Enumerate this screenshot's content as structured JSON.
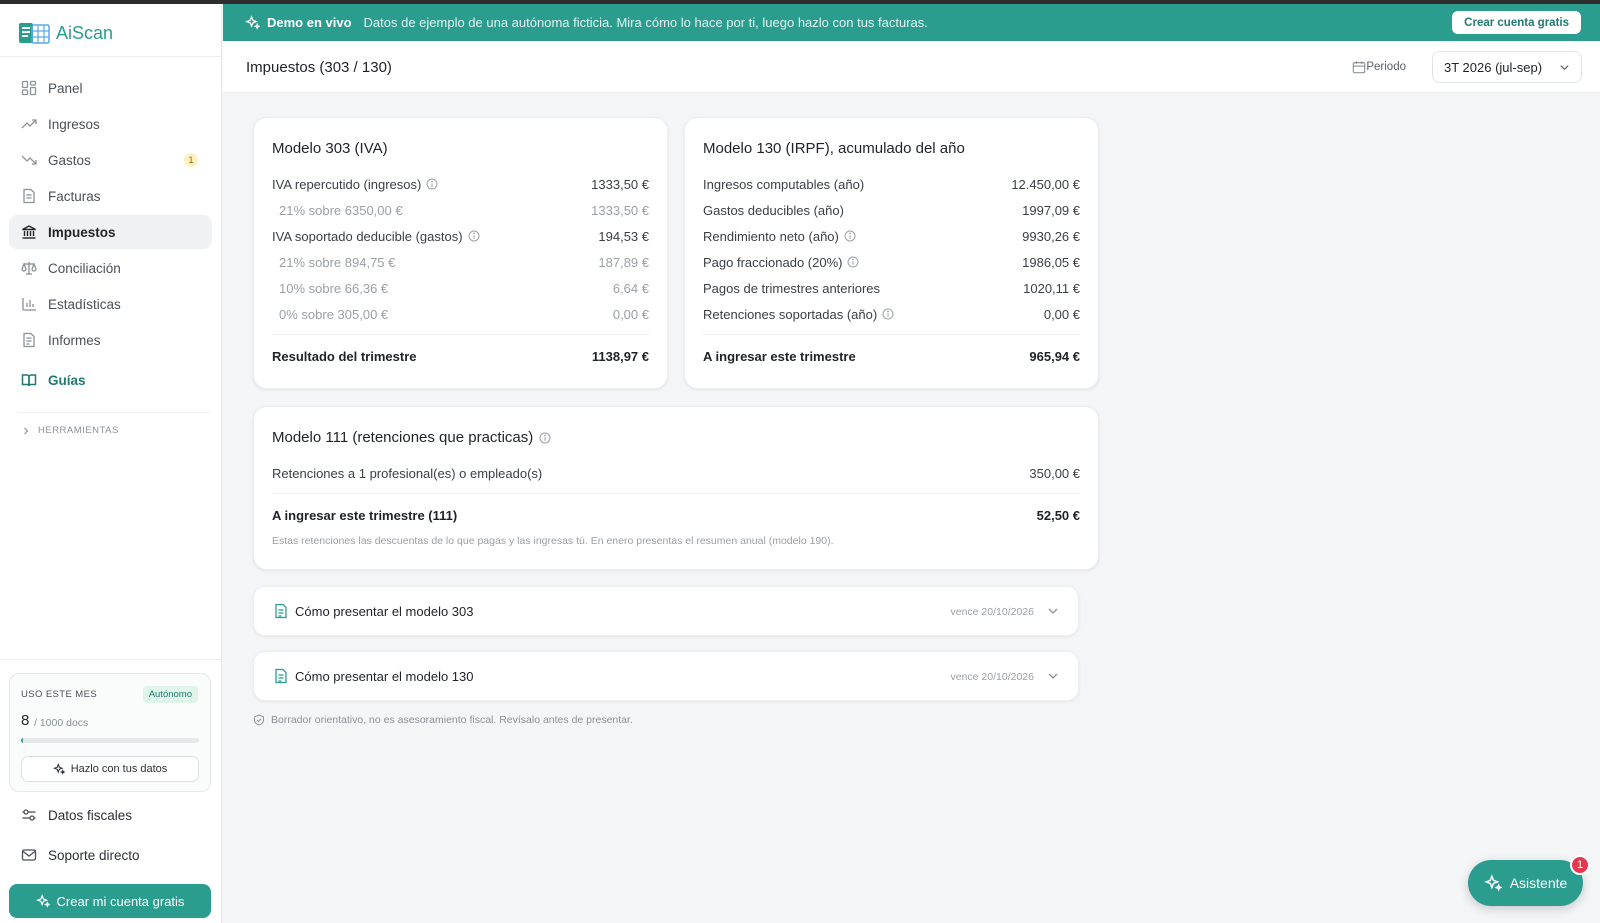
{
  "app": {
    "logo_text": "AiScan"
  },
  "sidebar": {
    "items": [
      {
        "label": "Panel",
        "icon": "dashboard-icon"
      },
      {
        "label": "Ingresos",
        "icon": "trend-up-icon"
      },
      {
        "label": "Gastos",
        "icon": "trend-down-icon",
        "badge": "1"
      },
      {
        "label": "Facturas",
        "icon": "document-icon"
      },
      {
        "label": "Impuestos",
        "icon": "bank-icon",
        "active": true
      },
      {
        "label": "Conciliación",
        "icon": "scale-icon"
      },
      {
        "label": "Estadísticas",
        "icon": "bar-chart-icon"
      },
      {
        "label": "Informes",
        "icon": "report-icon"
      }
    ],
    "guide_label": "Guías",
    "tools_label": "HERRAMIENTAS",
    "usage": {
      "label": "USO ESTE MES",
      "plan": "Autónomo",
      "count": "8",
      "total": "/ 1000 docs",
      "fraction": 0.008,
      "button": "Hazlo con tus datos"
    },
    "fiscal_data": "Datos fiscales",
    "support": "Soporte directo",
    "create_account": "Crear mi cuenta gratis"
  },
  "banner": {
    "title": "Demo en vivo",
    "text": "Datos de ejemplo de una autónoma ficticia. Mira cómo lo hace por ti, luego hazlo con tus facturas.",
    "button": "Crear cuenta gratis",
    "color": "#2a9d8f"
  },
  "header": {
    "title": "Impuestos (303 / 130)",
    "period_label": "Periodo",
    "period_value": "3T 2026 (jul-sep)"
  },
  "model303": {
    "title": "Modelo 303 (IVA)",
    "rows": [
      {
        "label": "IVA repercutido (ingresos)",
        "value": "1333,50 €",
        "info": true
      },
      {
        "label": "21% sobre 6350,00 €",
        "value": "1333,50 €",
        "sub": true
      },
      {
        "label": "IVA soportado deducible (gastos)",
        "value": "194,53 €",
        "info": true
      },
      {
        "label": "21% sobre 894,75 €",
        "value": "187,89 €",
        "sub": true
      },
      {
        "label": "10% sobre 66,36 €",
        "value": "6,64 €",
        "sub": true
      },
      {
        "label": "0% sobre 305,00 €",
        "value": "0,00 €",
        "sub": true
      }
    ],
    "total_label": "Resultado del trimestre",
    "total_value": "1138,97 €"
  },
  "model130": {
    "title": "Modelo 130 (IRPF), acumulado del año",
    "rows": [
      {
        "label": "Ingresos computables (año)",
        "value": "12.450,00 €"
      },
      {
        "label": "Gastos deducibles (año)",
        "value": "1997,09 €"
      },
      {
        "label": "Rendimiento neto (año)",
        "value": "9930,26 €",
        "info": true
      },
      {
        "label": "Pago fraccionado (20%)",
        "value": "1986,05 €",
        "info": true
      },
      {
        "label": "Pagos de trimestres anteriores",
        "value": "1020,11 €"
      },
      {
        "label": "Retenciones soportadas (año)",
        "value": "0,00 €",
        "info": true
      }
    ],
    "total_label": "A ingresar este trimestre",
    "total_value": "965,94 €"
  },
  "model111": {
    "title": "Modelo 111 (retenciones que practicas)",
    "row_label": "Retenciones a 1 profesional(es) o empleado(s)",
    "row_value": "350,00 €",
    "total_label": "A ingresar este trimestre (111)",
    "total_value": "52,50 €",
    "note": "Estas retenciones las descuentas de lo que pagas y las ingresas tú. En enero presentas el resumen anual (modelo 190)."
  },
  "accordions": [
    {
      "title": "Cómo presentar el modelo 303",
      "due": "vence 20/10/2026"
    },
    {
      "title": "Cómo presentar el modelo 130",
      "due": "vence 20/10/2026"
    }
  ],
  "disclaimer": "Borrador orientativo, no es asesoramiento fiscal. Revísalo antes de presentar.",
  "assistant": {
    "label": "Asistente",
    "badge": "1"
  }
}
